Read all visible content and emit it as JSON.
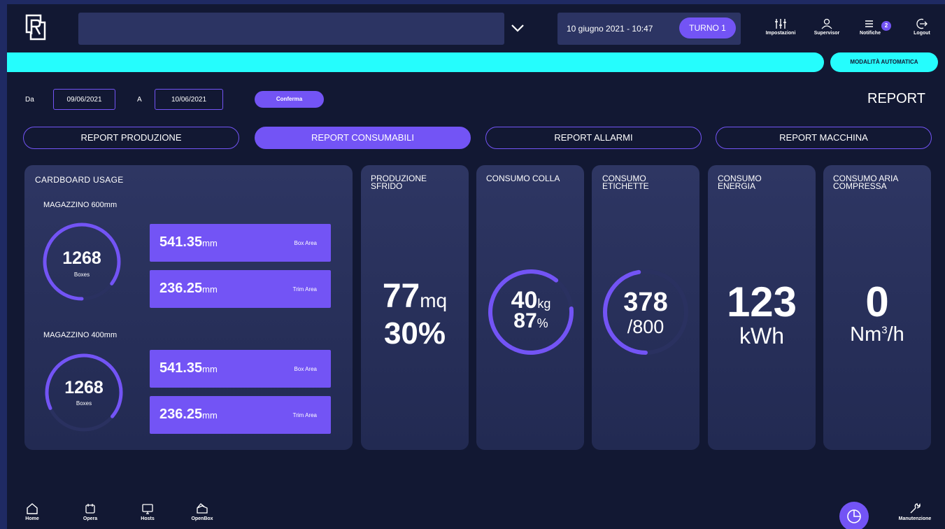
{
  "header": {
    "logo_letter": "R",
    "datetime": "10 giugno 2021 - 10:47",
    "shift": "TURNO 1",
    "icons": [
      {
        "name": "settings-icon",
        "label": "Impostazioni"
      },
      {
        "name": "user-icon",
        "label": "Supervisor"
      },
      {
        "name": "notifications-icon",
        "label": "Notifiche",
        "badge": "2"
      },
      {
        "name": "logout-icon",
        "label": "Logout"
      }
    ]
  },
  "status": {
    "mode": "MODALITÀ AUTOMATICA",
    "bar_color": "#25fdfd"
  },
  "filter": {
    "from_label": "Da",
    "from_value": "09/06/2021",
    "to_label": "A",
    "to_value": "10/06/2021",
    "confirm": "Conferma"
  },
  "page_title": "REPORT",
  "tabs": [
    {
      "label": "REPORT PRODUZIONE",
      "active": false
    },
    {
      "label": "REPORT CONSUMABILI",
      "active": true
    },
    {
      "label": "REPORT ALLARMI",
      "active": false
    },
    {
      "label": "REPORT MACCHINA",
      "active": false
    }
  ],
  "cardboard": {
    "title": "CARDBOARD USAGE",
    "warehouses": [
      {
        "name": "MAGAZZINO 600mm",
        "boxes": "1268",
        "boxes_label": "Boxes",
        "ring_fraction": 0.85,
        "box_area": {
          "value": "541.35",
          "unit": "mm",
          "label": "Box Area"
        },
        "trim_area": {
          "value": "236.25",
          "unit": "mm",
          "label": "Trim Area"
        }
      },
      {
        "name": "MAGAZZINO 400mm",
        "boxes": "1268",
        "boxes_label": "Boxes",
        "ring_fraction": 0.68,
        "box_area": {
          "value": "541.35",
          "unit": "mm",
          "label": "Box Area"
        },
        "trim_area": {
          "value": "236.25",
          "unit": "mm",
          "label": "Trim Area"
        }
      }
    ]
  },
  "stats": {
    "sfrido": {
      "title": "PRODUZIONE SFRIDO",
      "value": "77",
      "unit": "mq",
      "percent": "30%"
    },
    "colla": {
      "title": "CONSUMO COLLA",
      "value": "40",
      "unit": "kg",
      "percent": "87",
      "percent_unit": "%",
      "ring_fraction": 0.87
    },
    "etichette": {
      "title": "CONSUMO ETICHETTE",
      "value": "378",
      "total": "/800",
      "ring_fraction": 0.4725
    },
    "energia": {
      "title": "CONSUMO ENERGIA",
      "value": "123",
      "unit": "kWh"
    },
    "aria": {
      "title": "CONSUMO ARIA COMPRESSA",
      "value": "0",
      "unit": "Nm",
      "unit_sup": "3",
      "unit_tail": "/h"
    }
  },
  "bottom_nav": [
    {
      "name": "home-icon",
      "label": "Home"
    },
    {
      "name": "opera-icon",
      "label": "Opera"
    },
    {
      "name": "hosts-icon",
      "label": "Hosts"
    },
    {
      "name": "openbox-icon",
      "label": "OpenBox"
    },
    {
      "name": "manutenzione-icon",
      "label": "Manutenzione"
    }
  ],
  "colors": {
    "accent": "#7354f5",
    "cyan": "#25fdfd",
    "background": "#121833",
    "frame": "#1f2a63"
  }
}
